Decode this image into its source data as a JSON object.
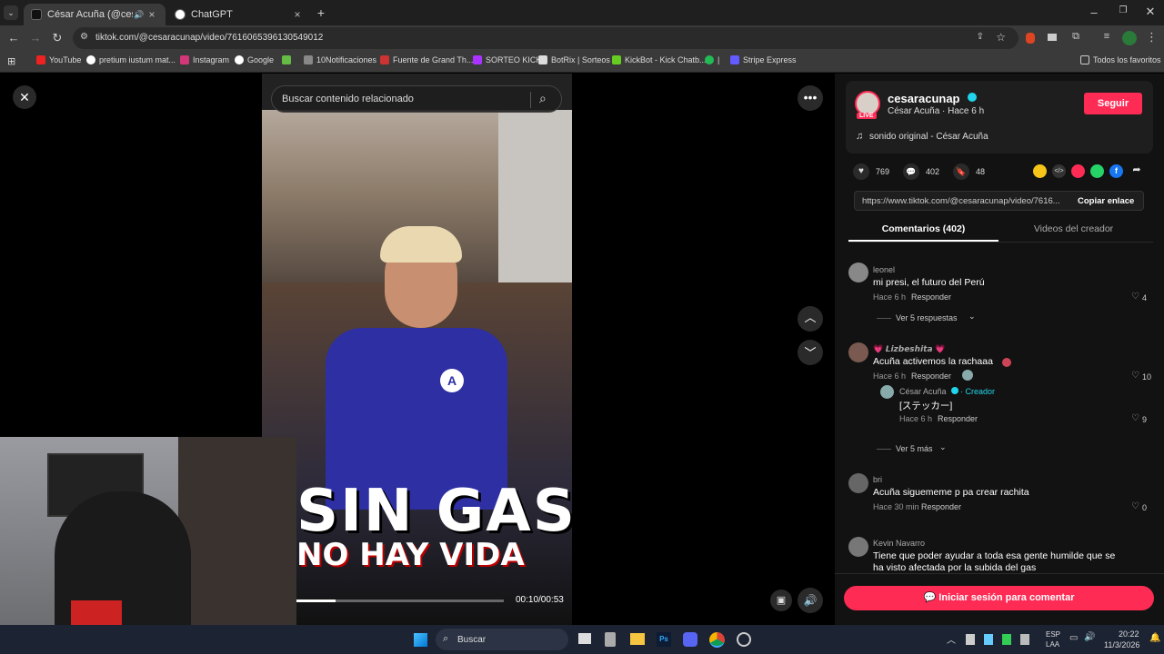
{
  "tabs": [
    {
      "title": "César Acuña (@cesaracuna...",
      "active": true
    },
    {
      "title": "ChatGPT",
      "active": false
    }
  ],
  "url": "tiktok.com/@cesaracunap/video/7616065396130549012",
  "bookmarks": [
    "YouTube",
    "pretium iustum mat...",
    "Instagram",
    "Google",
    "10Notificaciones",
    "Fuente de Grand Th...",
    "SORTEO KICK",
    "BotRix | Sorteos",
    "KickBot - Kick Chatb...",
    "|",
    "Stripe Express"
  ],
  "bookmarks_all": "Todos los favoritos",
  "search": {
    "placeholder": "Buscar contenido relacionado"
  },
  "video": {
    "overlay_line1": "SIN GAS",
    "overlay_line2": "NO HAY VIDA",
    "time": "00:10/00:53",
    "progress": 0.19
  },
  "creator": {
    "handle": "cesaracunap",
    "meta": "César Acuña · Hace 6 h",
    "live": "LIVE",
    "follow": "Seguir",
    "sound": "sonido original - César Acuña"
  },
  "stats": {
    "likes": "769",
    "comments": "402",
    "saves": "48"
  },
  "share_url": "https://www.tiktok.com/@cesaracunap/video/7616...",
  "copy_link": "Copiar enlace",
  "tabs2": {
    "comments": "Comentarios (402)",
    "videos": "Videos del creador"
  },
  "comments": [
    {
      "user": "leonel",
      "text": "mi presi, el futuro del Perú",
      "time": "Hace 6 h",
      "reply": "Responder",
      "likes": "4",
      "more": "Ver 5 respuestas"
    },
    {
      "user": "💗 𝙇𝙞𝙯𝙗𝙚𝙨𝙝𝙞𝙩𝙖 💗",
      "text": "Acuña activemos la rachaaa",
      "time": "Hace 6 h",
      "reply": "Responder",
      "likes": "10"
    },
    {
      "user": "César Acuña",
      "creator_tag": "· Creador",
      "text": "[ステッカー]",
      "time": "Hace 6 h",
      "reply": "Responder",
      "likes": "9",
      "more": "Ver 5 más"
    },
    {
      "user": "bri",
      "text": "Acuña siguememe p pa crear rachita",
      "time": "Hace 30 min",
      "reply": "Responder",
      "likes": "0"
    },
    {
      "user": "Kevin Navarro",
      "text": "Tiene que poder ayudar a toda esa gente humilde que se ha visto afectada por la subida del gas",
      "time": "",
      "reply": "",
      "likes": ""
    }
  ],
  "login_comment": "Iniciar sesión para comentar",
  "taskbar": {
    "search": "Buscar",
    "lang1": "ESP",
    "lang2": "LAA",
    "time": "20:22",
    "date": "11/3/2026"
  }
}
